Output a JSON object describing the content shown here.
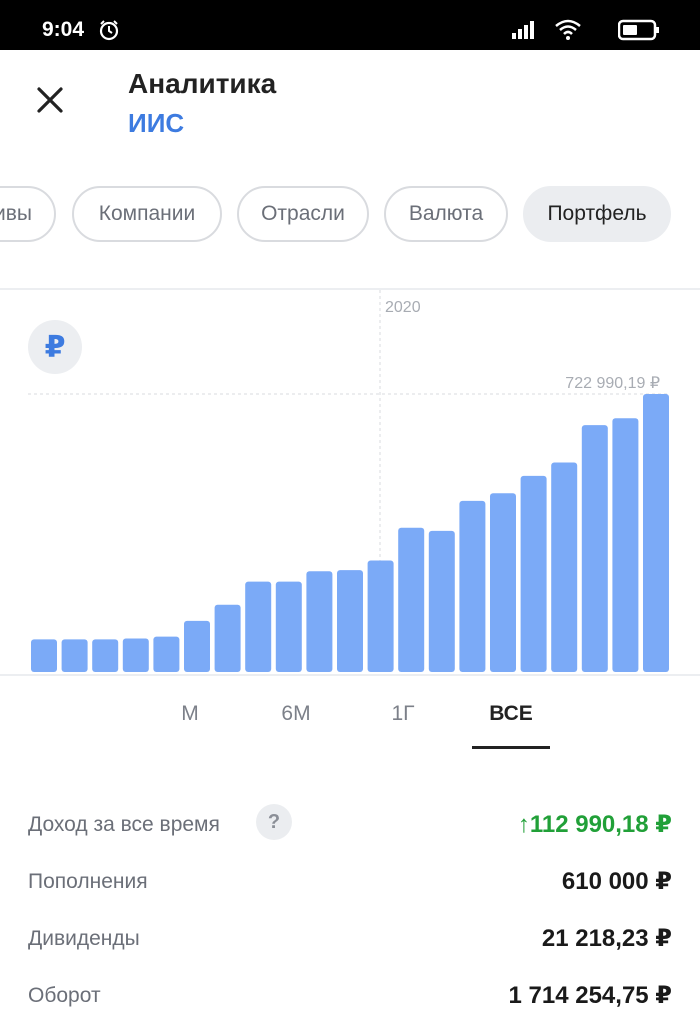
{
  "status_bar": {
    "time": "9:04"
  },
  "header": {
    "title": "Аналитика",
    "subtitle": "ИИС"
  },
  "chips": [
    "ивы",
    "Компании",
    "Отрасли",
    "Валюта",
    "Портфель"
  ],
  "chips_active_index": 4,
  "chart_data": {
    "type": "bar",
    "currency_badge": "₽",
    "year_marker": "2020",
    "max_label": "722 990,19 ₽",
    "max_value": 722990.19,
    "values": [
      85000,
      85000,
      85000,
      87000,
      92000,
      133000,
      175000,
      235000,
      235000,
      262000,
      265000,
      290000,
      375000,
      367000,
      445000,
      465000,
      510000,
      545000,
      642000,
      660000,
      722990.19
    ],
    "color": "#7baaf7"
  },
  "period_tabs": [
    "М",
    "6М",
    "1Г",
    "ВСЕ"
  ],
  "period_active_index": 3,
  "stats": {
    "income_label": "Доход за все время",
    "help": "?",
    "income_value": "↑112 990,18 ₽",
    "deposits_label": "Пополнения",
    "deposits_value": "610 000 ₽",
    "dividends_label": "Дивиденды",
    "dividends_value": "21 218,23 ₽",
    "turnover_label": "Оборот",
    "turnover_value": "1 714 254,75 ₽"
  },
  "colors": {
    "accent": "#3d7be0",
    "positive": "#21a038",
    "bar": "#7baaf7"
  }
}
